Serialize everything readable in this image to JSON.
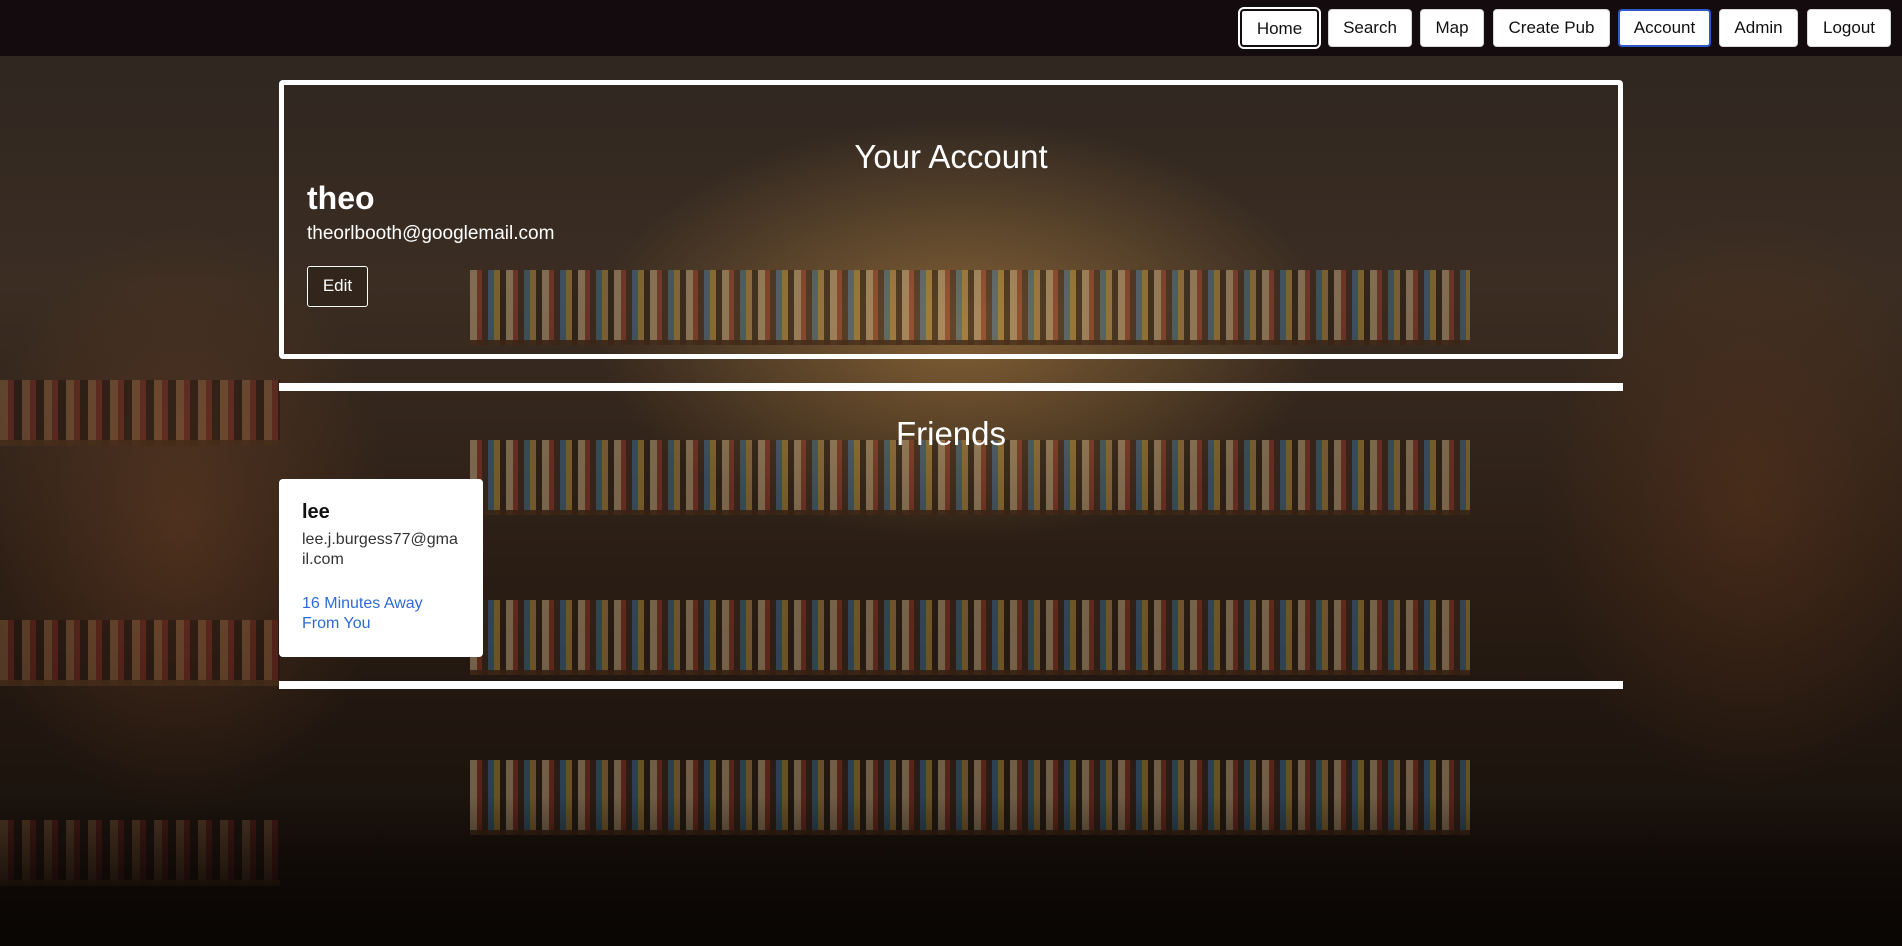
{
  "nav": {
    "items": [
      {
        "label": "Home"
      },
      {
        "label": "Search"
      },
      {
        "label": "Map"
      },
      {
        "label": "Create Pub"
      },
      {
        "label": "Account"
      },
      {
        "label": "Admin"
      },
      {
        "label": "Logout"
      }
    ],
    "active": "Account"
  },
  "account": {
    "title": "Your Account",
    "username": "theo",
    "email": "theorlbooth@googlemail.com",
    "edit_label": "Edit"
  },
  "friends": {
    "title": "Friends",
    "list": [
      {
        "name": "lee",
        "email": "lee.j.burgess77@gmail.com",
        "distance": "16 Minutes Away From You"
      }
    ]
  },
  "colors": {
    "navbar": "#140b0e",
    "accent_active": "#2f58c8",
    "link": "#2f6bd6"
  }
}
